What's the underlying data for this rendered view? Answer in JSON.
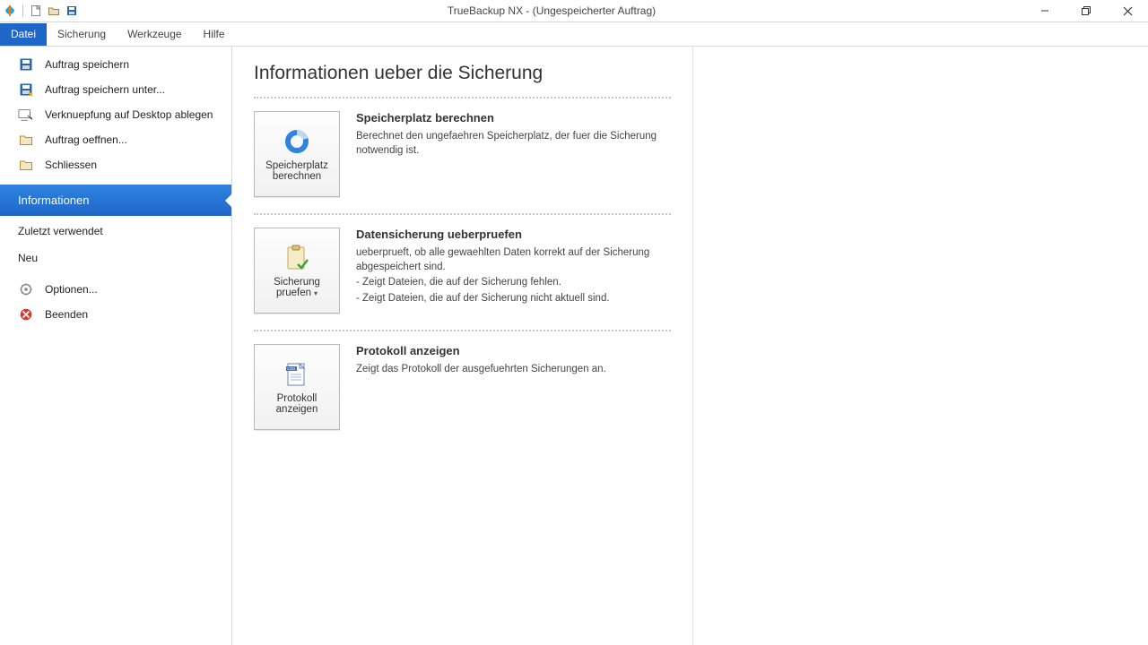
{
  "window": {
    "title": "TrueBackup NX - (Ungespeicherter Auftrag)"
  },
  "ribbon": {
    "tabs": [
      {
        "label": "Datei"
      },
      {
        "label": "Sicherung"
      },
      {
        "label": "Werkzeuge"
      },
      {
        "label": "Hilfe"
      }
    ]
  },
  "sidebar": {
    "items_top": [
      {
        "label": "Auftrag speichern"
      },
      {
        "label": "Auftrag speichern unter..."
      },
      {
        "label": "Verknuepfung auf Desktop ablegen"
      },
      {
        "label": "Auftrag oeffnen..."
      },
      {
        "label": "Schliessen"
      }
    ],
    "active": {
      "label": "Informationen"
    },
    "cats": [
      {
        "label": "Zuletzt verwendet"
      },
      {
        "label": "Neu"
      }
    ],
    "items_bottom": [
      {
        "label": "Optionen..."
      },
      {
        "label": "Beenden"
      }
    ]
  },
  "content": {
    "heading": "Informationen ueber die Sicherung",
    "cards": [
      {
        "btn_label": "Speicherplatz berechnen",
        "title": "Speicherplatz berechnen",
        "lines": [
          "Berechnet den ungefaehren Speicherplatz, der fuer die Sicherung notwendig ist."
        ]
      },
      {
        "btn_label": "Sicherung pruefen",
        "has_dropdown": true,
        "title": "Datensicherung ueberpruefen",
        "lines": [
          "ueberprueft, ob alle gewaehlten Daten korrekt auf der Sicherung abgespeichert sind.",
          "- Zeigt Dateien, die auf der Sicherung fehlen.",
          "- Zeigt Dateien, die auf der Sicherung nicht aktuell sind."
        ]
      },
      {
        "btn_label": "Protokoll anzeigen",
        "title": "Protokoll anzeigen",
        "lines": [
          "Zeigt das Protokoll der ausgefuehrten Sicherungen an."
        ]
      }
    ]
  }
}
